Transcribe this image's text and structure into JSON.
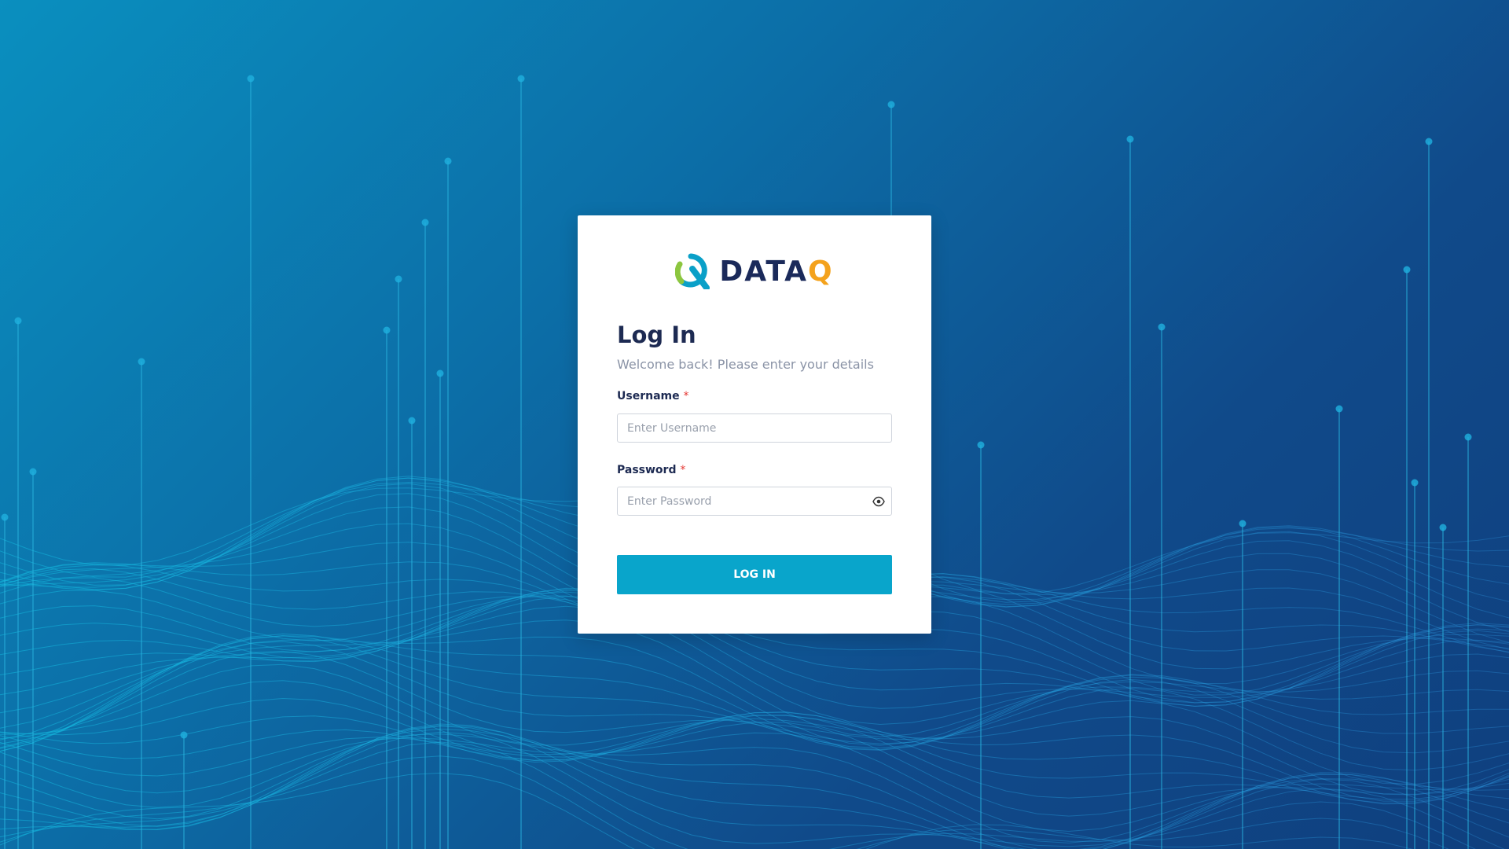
{
  "brand": {
    "name_main": "DATA",
    "name_accent": "Q",
    "colors": {
      "navy": "#1b2a5a",
      "orange": "#f4a21c",
      "teal": "#0aa0c8",
      "green": "#8cc63f"
    }
  },
  "login": {
    "title": "Log In",
    "subtitle": "Welcome back! Please enter your details",
    "username_label": "Username",
    "username_placeholder": "Enter Username",
    "password_label": "Password",
    "password_placeholder": "Enter Password",
    "required_mark": "*",
    "submit_label": "LOG IN",
    "password_toggle_icon": "eye-icon"
  },
  "colors": {
    "button": "#09a5cb",
    "title": "#1d2a52",
    "required": "#e53935"
  }
}
